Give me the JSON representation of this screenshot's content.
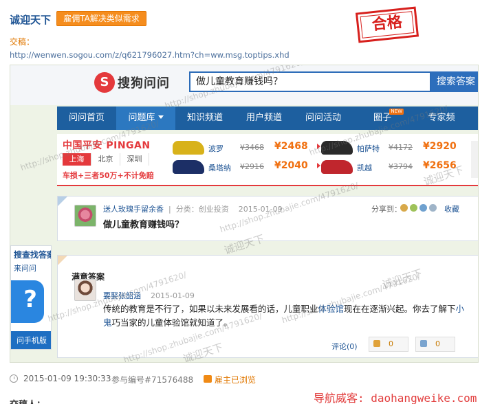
{
  "header": {
    "user_name": "诚迎天下",
    "hire_button": "雇佣TA解决类似需求",
    "stamp": "合格",
    "draft_label": "交稿：",
    "draft_url": "http://wenwen.sogou.com/z/q621796027.htm?ch=ww.msg.toptips.xhd"
  },
  "screenshot": {
    "logo_mark": "S",
    "logo_text": "搜狗问问",
    "search_value": "做儿童教育赚钱吗？",
    "search_button": "搜索答案",
    "nav": [
      "问问首页",
      "问题库",
      "知识频道",
      "用户频道",
      "问问活动",
      "圈子",
      "专家频"
    ],
    "nav_badge": "NEW",
    "ad": {
      "brand": "中国平安 PINGAN",
      "cities": [
        "上海",
        "北京",
        "深圳"
      ],
      "slogan": "车损+三者50万+不计免赔",
      "cars": [
        {
          "model": "波罗",
          "old": "¥3468",
          "new": "¥2468",
          "color": "#d8b21a"
        },
        {
          "model": "帕萨特",
          "old": "¥4172",
          "new": "¥2920",
          "color": "#2a2a2a"
        },
        {
          "model": "桑塔纳",
          "old": "¥2916",
          "new": "¥2040",
          "color": "#1c2f66"
        },
        {
          "model": "凯越",
          "old": "¥3794",
          "new": "¥2656",
          "color": "#c0262d"
        }
      ]
    },
    "question": {
      "user": "送人玫瑰手留余香",
      "category": "分类：创业投资",
      "date": "2015-01-09",
      "title": "做儿童教育赚钱吗？",
      "share": "分享到：",
      "fav": "收藏"
    },
    "side_app": {
      "line1": "搜查找答案",
      "line2": "来问问",
      "line3": "问手机版"
    },
    "answer": {
      "heading": "满意答案",
      "user": "要娶张韶涵",
      "date": "2015-01-09",
      "text_before": "传统的教育是不行了，如果以未来发展看的话，儿童职业",
      "link1": "体验馆",
      "text_middle": "现在在逐渐兴起。你去了解下",
      "link2": "小鬼",
      "text_end": "巧当家的儿童体验馆就知道了。",
      "comment": "评论(0)",
      "up_count": "0",
      "down_count": "0"
    },
    "watermarks": [
      "http://shop.zhubajie.com/4791620/",
      "诚迎天下"
    ]
  },
  "footer": {
    "time": "2015-01-09 19:30:33",
    "ref": "参与编号#71576488",
    "employer_status": "雇主已浏览",
    "site_watermark": "导航威客: daohangweike.com",
    "cut_text": "交稿人："
  }
}
